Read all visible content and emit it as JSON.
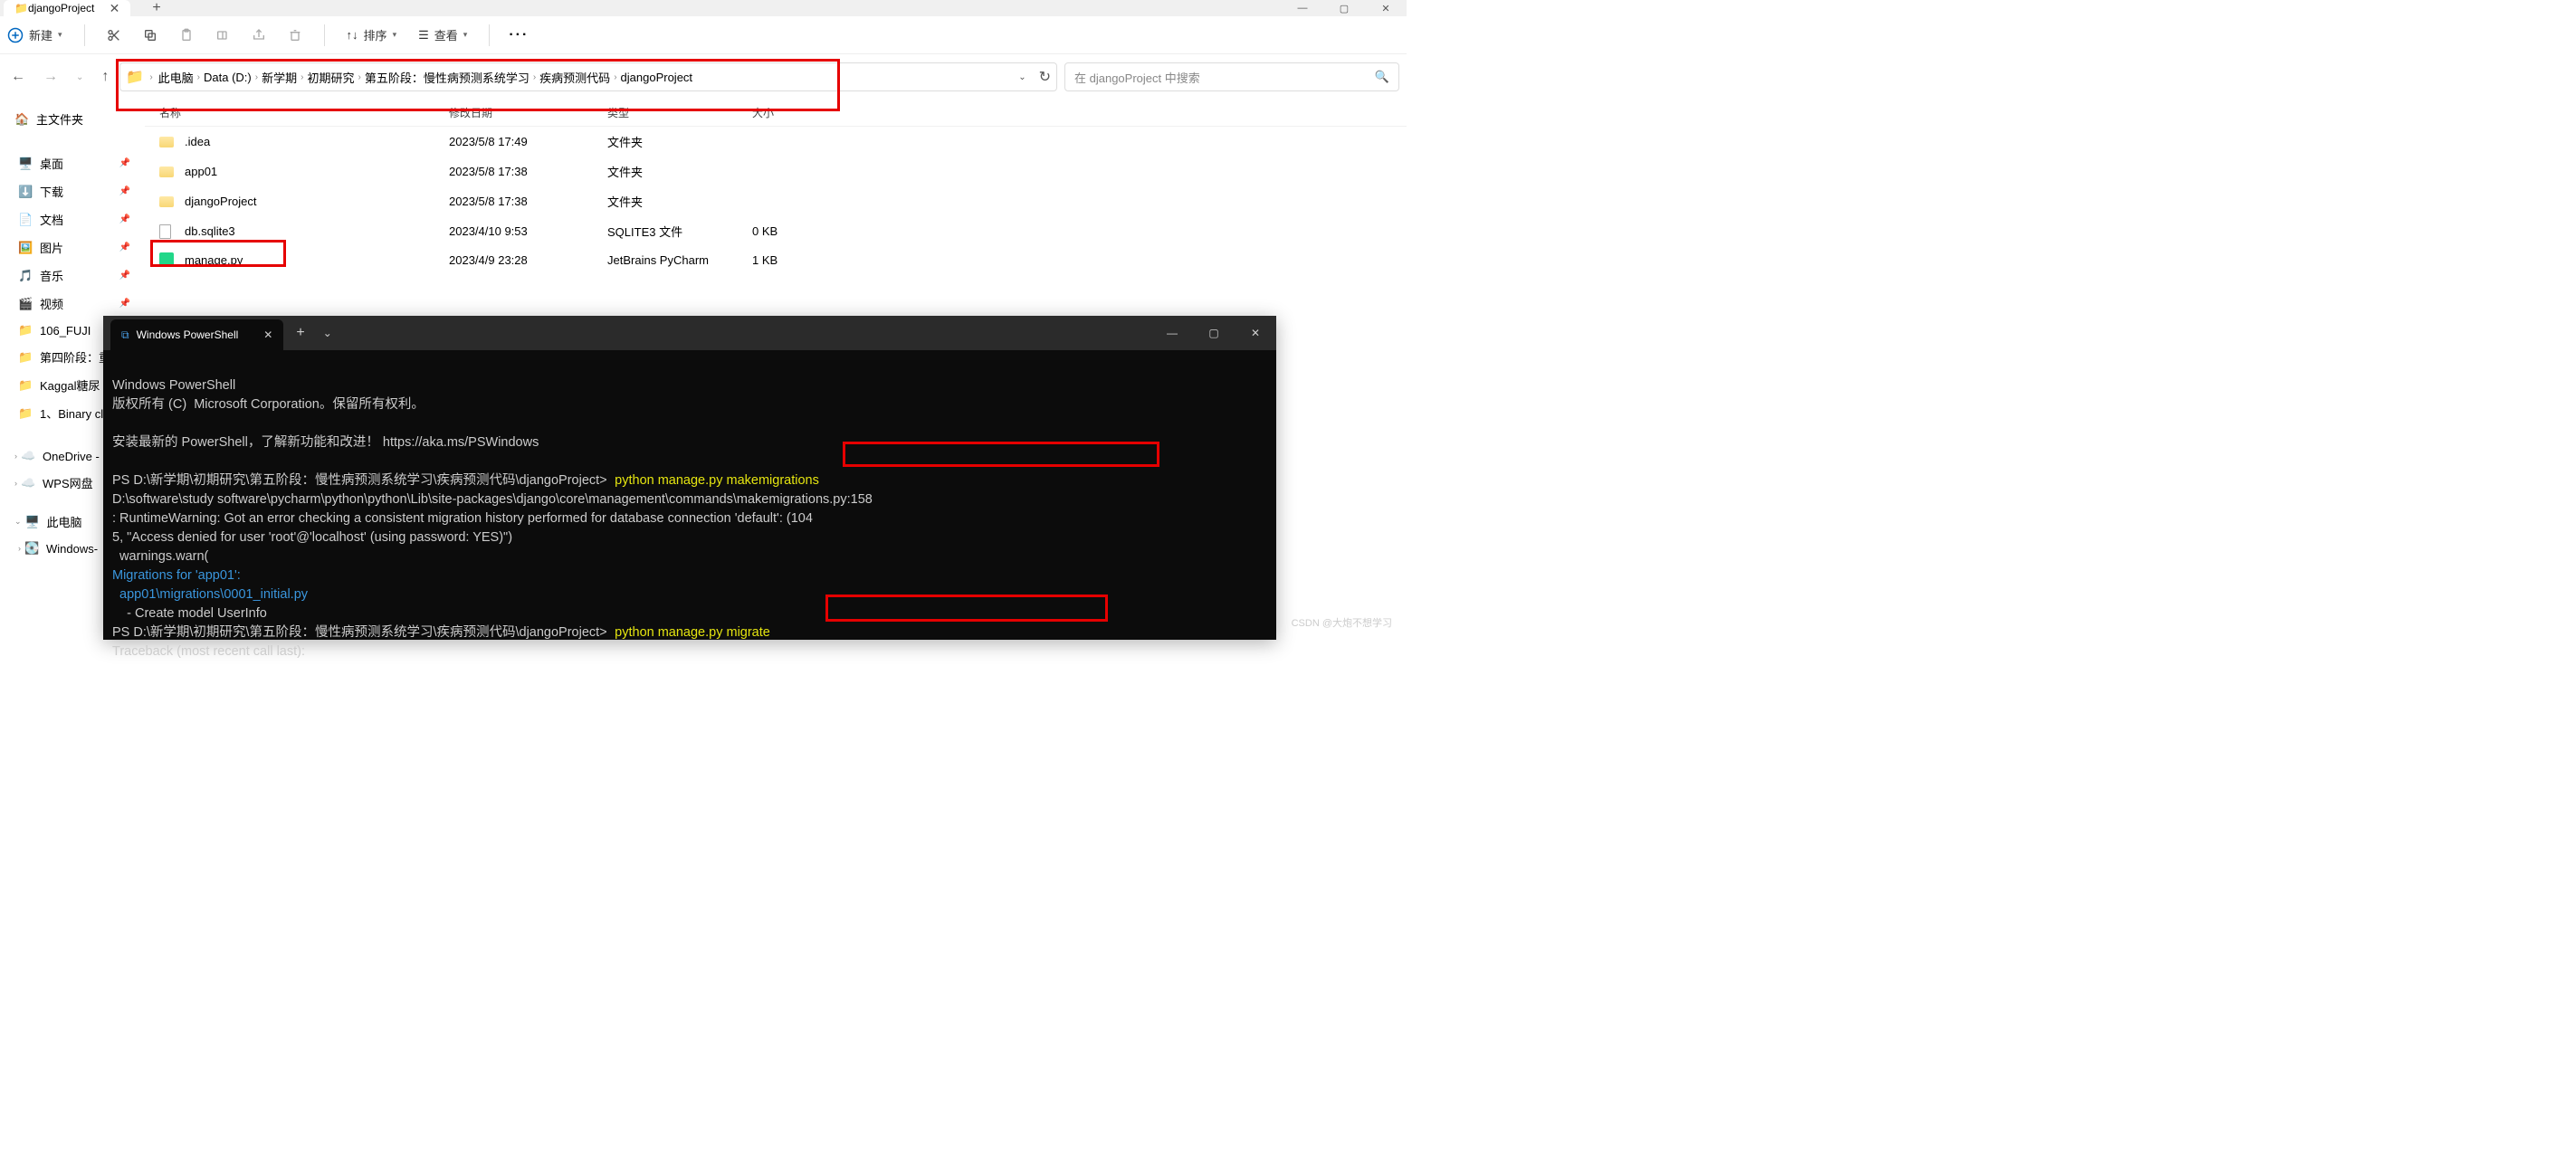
{
  "explorer": {
    "tab_title": "djangoProject",
    "toolbar": {
      "new": "新建",
      "sort": "排序",
      "view": "查看"
    },
    "breadcrumb": [
      "此电脑",
      "Data (D:)",
      "新学期",
      "初期研究",
      "第五阶段：慢性病预测系统学习",
      "疾病预测代码",
      "djangoProject"
    ],
    "search_placeholder": "在 djangoProject 中搜索",
    "columns": {
      "name": "名称",
      "date": "修改日期",
      "type": "类型",
      "size": "大小"
    },
    "files": [
      {
        "name": ".idea",
        "date": "2023/5/8 17:49",
        "type": "文件夹",
        "size": "",
        "icon": "folder"
      },
      {
        "name": "app01",
        "date": "2023/5/8 17:38",
        "type": "文件夹",
        "size": "",
        "icon": "folder"
      },
      {
        "name": "djangoProject",
        "date": "2023/5/8 17:38",
        "type": "文件夹",
        "size": "",
        "icon": "folder"
      },
      {
        "name": "db.sqlite3",
        "date": "2023/4/10 9:53",
        "type": "SQLITE3 文件",
        "size": "0 KB",
        "icon": "file"
      },
      {
        "name": "manage.py",
        "date": "2023/4/9 23:28",
        "type": "JetBrains PyCharm",
        "size": "1 KB",
        "icon": "py"
      }
    ],
    "sidebar": {
      "home": "主文件夹",
      "desktop": "桌面",
      "downloads": "下载",
      "documents": "文档",
      "pictures": "图片",
      "music": "音乐",
      "videos": "视频",
      "folder1": "106_FUJI",
      "folder2": "第四阶段：重",
      "folder3": "Kaggal糖尿",
      "folder4": "1、Binary cl",
      "onedrive": "OneDrive -",
      "wps": "WPS网盘",
      "thispc": "此电脑",
      "windows": "Windows-"
    }
  },
  "terminal": {
    "tab_title": "Windows PowerShell",
    "lines": {
      "l1": "Windows PowerShell",
      "l2": "版权所有 (C)  Microsoft Corporation。保留所有权利。",
      "l3": "安装最新的 PowerShell，了解新功能和改进！ https://aka.ms/PSWindows",
      "prompt1": "PS D:\\新学期\\初期研究\\第五阶段：慢性病预测系统学习\\疾病预测代码\\djangoProject>",
      "cmd1": "python manage.py makemigrations",
      "l5": "D:\\software\\study software\\pycharm\\python\\python\\Lib\\site-packages\\django\\core\\management\\commands\\makemigrations.py:158",
      "l6": ": RuntimeWarning: Got an error checking a consistent migration history performed for database connection 'default': (104",
      "l7": "5, \"Access denied for user 'root'@'localhost' (using password: YES)\")",
      "l8": "  warnings.warn(",
      "l9": "Migrations for 'app01':",
      "l10": "  app01\\migrations\\0001_initial.py",
      "l11": "    - Create model UserInfo",
      "prompt2": "PS D:\\新学期\\初期研究\\第五阶段：慢性病预测系统学习\\疾病预测代码\\djangoProject>",
      "cmd2": "python manage.py migrate",
      "l12": "Traceback (most recent call last):"
    }
  },
  "watermark": "CSDN @大炮不想学习"
}
